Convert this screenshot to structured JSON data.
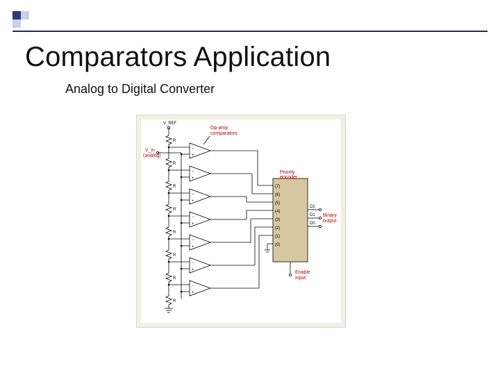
{
  "header": {
    "title": "Comparators Application",
    "subtitle": "Analog to Digital Converter"
  },
  "diagram": {
    "top_left_label": "V_REF",
    "input_label_top": "V_in",
    "input_label_bottom": "(analog)",
    "component_label": "Op-amp\ncomparators",
    "encoder_label": "Priority\nencoder",
    "outputs_header": "Binary\noutput",
    "enable_label": "Enable\ninput",
    "resistor_label": "R",
    "encoder_inputs": [
      "(7)",
      "(6)",
      "(5)",
      "(4)",
      "(3)",
      "(2)",
      "(1)",
      "(0)"
    ],
    "encoder_outputs": [
      "D2",
      "D1",
      "D0"
    ]
  },
  "chart_data": {
    "type": "table",
    "title": "Flash ADC (op-amp comparator ladder + priority encoder)",
    "components": [
      {
        "name": "V_REF",
        "role": "reference supply feeding resistor ladder"
      },
      {
        "name": "Resistor ladder",
        "count": 8,
        "value_label": "R"
      },
      {
        "name": "Op-amp comparators",
        "count": 7,
        "inputs": [
          "ladder tap (−)",
          "V_in (+)"
        ],
        "output": "logic level"
      },
      {
        "name": "Priority encoder",
        "inputs": 8,
        "input_labels": [
          "(7)",
          "(6)",
          "(5)",
          "(4)",
          "(3)",
          "(2)",
          "(1)",
          "(0)"
        ],
        "outputs": [
          "D2",
          "D1",
          "D0"
        ],
        "enable": "Enable input"
      },
      {
        "name": "V_in",
        "role": "analog input bus to all comparator + inputs"
      }
    ]
  }
}
